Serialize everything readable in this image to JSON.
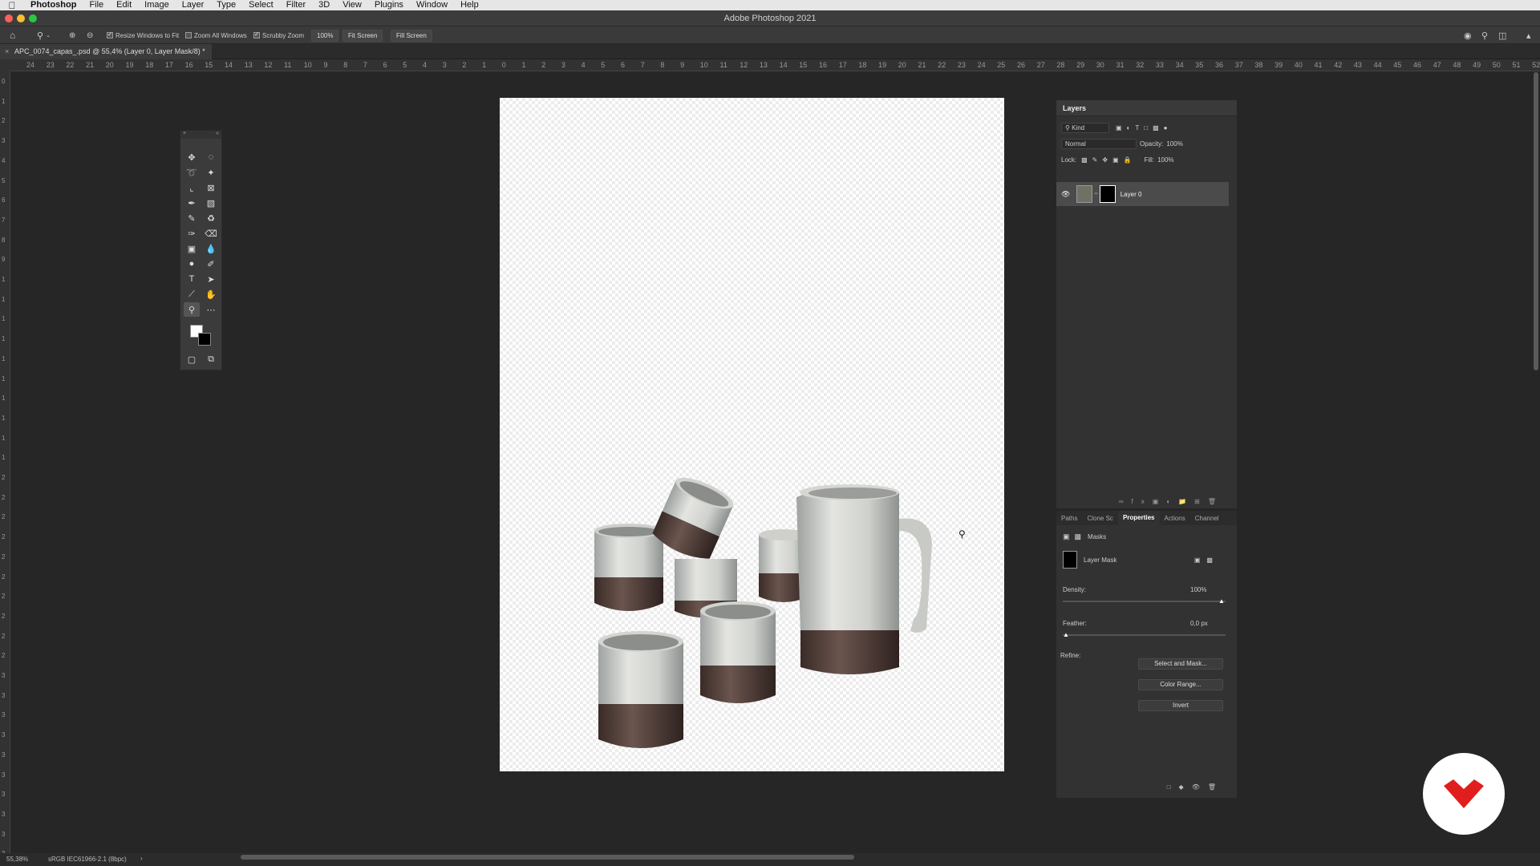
{
  "menubar": {
    "app": "Photoshop",
    "items": [
      "File",
      "Edit",
      "Image",
      "Layer",
      "Type",
      "Select",
      "Filter",
      "3D",
      "View",
      "Plugins",
      "Window",
      "Help"
    ]
  },
  "window": {
    "title": "Adobe Photoshop 2021"
  },
  "options": {
    "resize_windows": "Resize Windows to Fit",
    "zoom_all": "Zoom All Windows",
    "scrubby": "Scrubby Zoom",
    "zoom_value": "100%",
    "fit_screen": "Fit Screen",
    "fill_screen": "Fill Screen"
  },
  "document": {
    "tab": "APC_0074_capas_.psd @ 55,4% (Layer 0, Layer Mask/8) *"
  },
  "ruler": {
    "h": [
      "24",
      "23",
      "22",
      "21",
      "20",
      "19",
      "18",
      "17",
      "16",
      "15",
      "14",
      "13",
      "12",
      "11",
      "10",
      "9",
      "8",
      "7",
      "6",
      "5",
      "4",
      "3",
      "2",
      "1",
      "0",
      "1",
      "2",
      "3",
      "4",
      "5",
      "6",
      "7",
      "8",
      "9",
      "10",
      "11",
      "12",
      "13",
      "14",
      "15",
      "16",
      "17",
      "18",
      "19",
      "20",
      "21",
      "22",
      "23",
      "24",
      "25",
      "26",
      "27",
      "28",
      "29",
      "30",
      "31",
      "32",
      "33",
      "34",
      "35",
      "36",
      "37",
      "38",
      "39",
      "40",
      "41",
      "42",
      "43",
      "44",
      "45",
      "46",
      "47",
      "48",
      "49",
      "50",
      "51",
      "52"
    ],
    "v": [
      "0",
      "1",
      "2",
      "3",
      "4",
      "5",
      "6",
      "7",
      "8",
      "9",
      "1",
      "1",
      "1",
      "1",
      "1",
      "1",
      "1",
      "1",
      "1",
      "1",
      "2",
      "2",
      "2",
      "2",
      "2",
      "2",
      "2",
      "2",
      "2",
      "2",
      "3",
      "3",
      "3",
      "3",
      "3",
      "3",
      "3",
      "3",
      "3",
      "3"
    ]
  },
  "layers": {
    "title": "Layers",
    "kind": "Kind",
    "blend": "Normal",
    "opacity_label": "Opacity:",
    "opacity": "100%",
    "lock_label": "Lock:",
    "fill_label": "Fill:",
    "fill": "100%",
    "layer_name": "Layer 0"
  },
  "properties": {
    "tabs": [
      "Paths",
      "Clone Sc",
      "Properties",
      "Actions",
      "Channel"
    ],
    "active_tab": "Properties",
    "masks_label": "Masks",
    "mask_name": "Layer Mask",
    "density_label": "Density:",
    "density": "100%",
    "feather_label": "Feather:",
    "feather": "0,0 px",
    "refine_label": "Refine:",
    "select_mask": "Select and Mask...",
    "color_range": "Color Range...",
    "invert": "Invert"
  },
  "status": {
    "zoom": "55,38%",
    "profile": "sRGB IEC61966-2.1 (8bpc)"
  },
  "colors": {
    "accent": "#e01e1e"
  }
}
